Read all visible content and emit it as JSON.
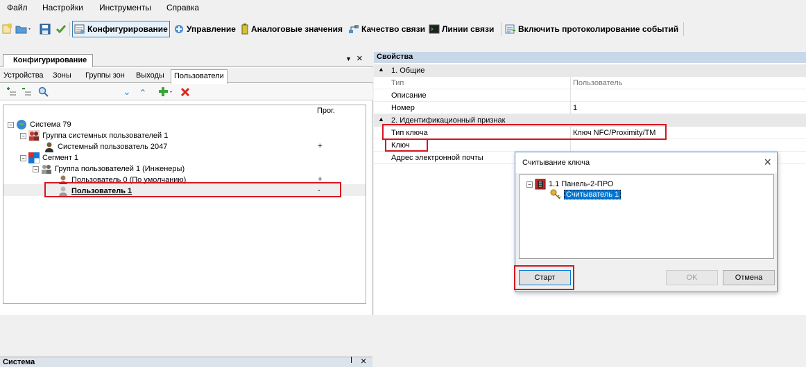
{
  "menu": [
    "Файл",
    "Настройки",
    "Инструменты",
    "Справка"
  ],
  "toolbar": {
    "configure": "Конфигурирование",
    "control": "Управление",
    "analog": "Аналоговые значения",
    "link_quality": "Качество связи",
    "comm_lines": "Линии связи",
    "logging": "Включить протоколирование событий"
  },
  "left": {
    "title": "Конфигурирование",
    "tabs": [
      "Устройства",
      "Зоны",
      "Группы зон",
      "Выходы",
      "Пользователи"
    ],
    "col_prog": "Прог.",
    "tree": [
      {
        "label": "Система 79",
        "prog": ""
      },
      {
        "label": "Группа системных пользователей 1",
        "prog": ""
      },
      {
        "label": "Системный пользователь 2047",
        "prog": "+"
      },
      {
        "label": "Сегмент 1",
        "prog": ""
      },
      {
        "label": "Группа пользователей 1 (Инженеры)",
        "prog": ""
      },
      {
        "label": "Пользователь 0 (По умолчанию)",
        "prog": "+"
      },
      {
        "label": "Пользователь 1",
        "prog": "-"
      }
    ],
    "bottom_title": "Система"
  },
  "right": {
    "title": "Свойства",
    "cat1": "1. Общие",
    "rows1": [
      {
        "name": "Тип",
        "value": "Пользователь"
      },
      {
        "name": "Описание",
        "value": ""
      },
      {
        "name": "Номер",
        "value": "1"
      }
    ],
    "cat2": "2. Идентификационный признак",
    "rows2": [
      {
        "name": "Тип ключа",
        "value": "Ключ NFC/Proximity/TM"
      },
      {
        "name": "Ключ",
        "value": ""
      },
      {
        "name": "Адрес электронной почты",
        "value": ""
      }
    ]
  },
  "dialog": {
    "title": "Считывание ключа",
    "panel": "1.1 Панель-2-ПРО",
    "reader": "Считыватель 1",
    "start": "Старт",
    "ok": "OK",
    "cancel": "Отмена"
  }
}
